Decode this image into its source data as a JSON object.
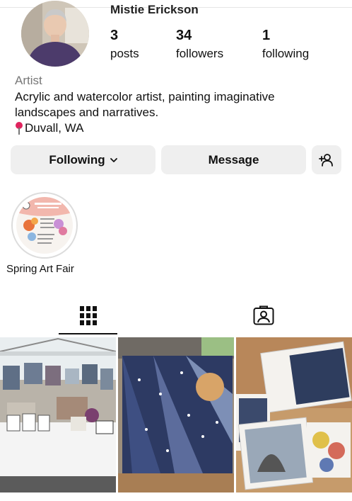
{
  "profile": {
    "name": "Mistie Erickson",
    "stats": [
      {
        "num": "3",
        "label": "posts"
      },
      {
        "num": "34",
        "label": "followers"
      },
      {
        "num": "1",
        "label": "following"
      }
    ],
    "category": "Artist",
    "bio_line1": "Acrylic and watercolor artist, painting imaginative",
    "bio_line2": "landscapes and narratives.",
    "location": "Duvall, WA"
  },
  "actions": {
    "following_label": "Following",
    "message_label": "Message"
  },
  "highlights": [
    {
      "label": "Spring Art Fair"
    }
  ],
  "tabs": [
    {
      "icon": "grid-icon",
      "active": true
    },
    {
      "icon": "tagged-icon",
      "active": false
    }
  ],
  "colors": {
    "button_bg": "#efefef",
    "pin": "#e0245e",
    "secondary_text": "#777777"
  }
}
